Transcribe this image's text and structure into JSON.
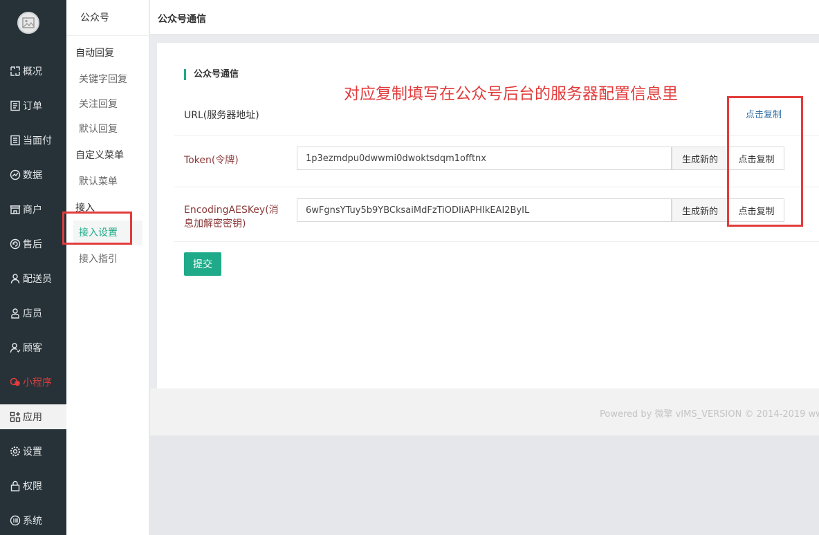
{
  "nav": {
    "items": [
      {
        "label": "概况",
        "icon": "overview-icon"
      },
      {
        "label": "订单",
        "icon": "order-icon"
      },
      {
        "label": "当面付",
        "icon": "face-pay-icon"
      },
      {
        "label": "数据",
        "icon": "data-icon"
      },
      {
        "label": "商户",
        "icon": "store-icon"
      },
      {
        "label": "售后",
        "icon": "aftersale-icon"
      },
      {
        "label": "配送员",
        "icon": "courier-icon"
      },
      {
        "label": "店员",
        "icon": "clerk-icon"
      },
      {
        "label": "顾客",
        "icon": "customer-icon"
      },
      {
        "label": "小程序",
        "icon": "mini-program-icon"
      },
      {
        "label": "应用",
        "icon": "apps-icon"
      },
      {
        "label": "设置",
        "icon": "settings-icon"
      },
      {
        "label": "权限",
        "icon": "lock-icon"
      },
      {
        "label": "系统",
        "icon": "system-icon"
      }
    ],
    "active_index": 10
  },
  "submenu": {
    "title": "公众号",
    "group_auto_reply": "自动回复",
    "keyword_reply": "关键字回复",
    "follow_reply": "关注回复",
    "default_reply": "默认回复",
    "group_custom_menu": "自定义菜单",
    "default_menu": "默认菜单",
    "group_access": "接入",
    "access_settings": "接入设置",
    "access_guide": "接入指引"
  },
  "header": {
    "title": "公众号通信"
  },
  "main": {
    "section_title": "公众号通信",
    "url_label": "URL(服务器地址)",
    "url_copy": "点击复制",
    "token_label": "Token(令牌)",
    "token_value": "1p3ezmdpu0dwwmi0dwoktsdqm1offtnx",
    "aes_label": "EncodingAESKey(消息加解密密钥)",
    "aes_value": "6wFgnsYTuy5b9YBCksaiMdFzTiODIiAPHIkEAI2ByIL",
    "generate_label": "生成新的",
    "copy_label": "点击复制",
    "submit_label": "提交"
  },
  "annotation": {
    "text": "对应复制填写在公众号后台的服务器配置信息里",
    "color": "#e23c3c"
  },
  "footer": {
    "text": "Powered by 微擎 vIMS_VERSION © 2014-2019 ww"
  },
  "colors": {
    "accent": "#1fab89",
    "nav_bg": "#263238",
    "annotation": "#e23c3c"
  }
}
